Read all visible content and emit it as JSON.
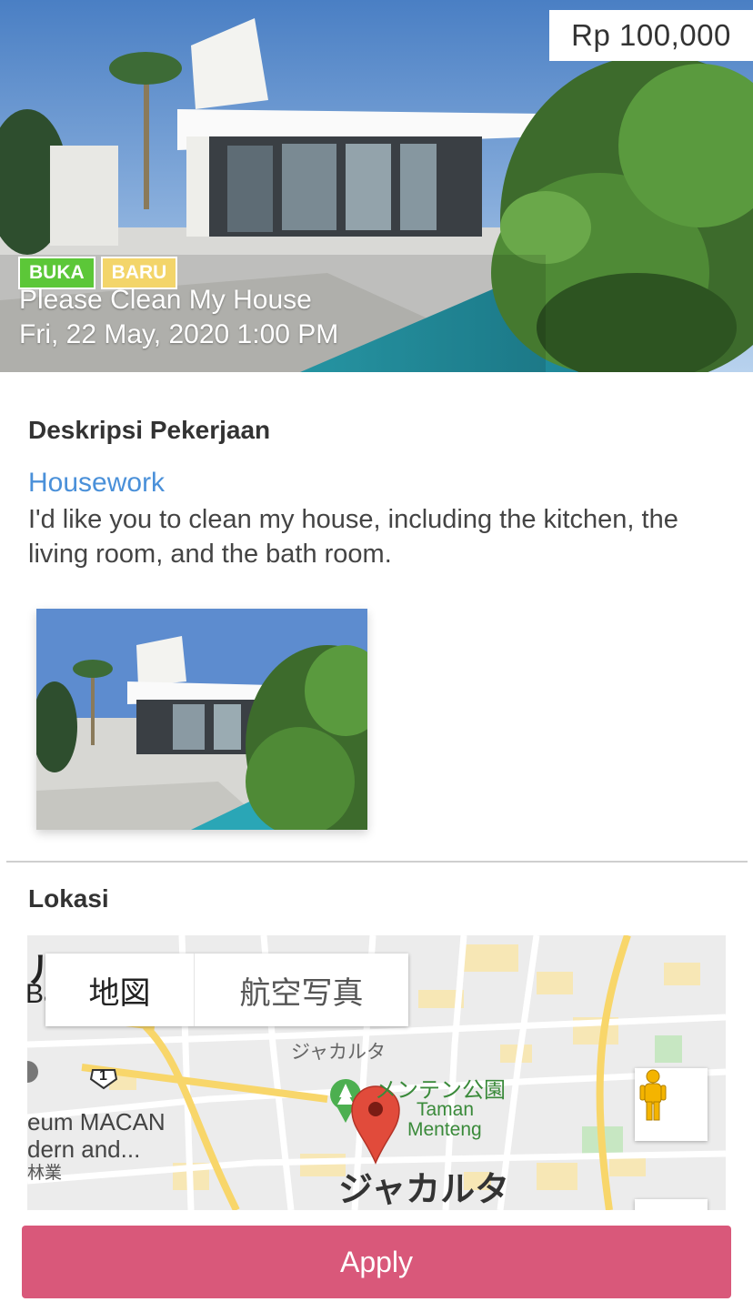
{
  "job": {
    "price": "Rp 100,000",
    "badges": {
      "status": "BUKA",
      "new": "BARU"
    },
    "title": "Please Clean My House",
    "datetime": "Fri, 22 May, 2020 1:00 PM"
  },
  "description": {
    "heading": "Deskripsi Pekerjaan",
    "category": "Housework",
    "text": "I'd like you to clean my house, including the kitchen, the living room, and the bath room."
  },
  "location": {
    "heading": "Lokasi",
    "map_type": {
      "map": "地図",
      "satellite": "航空写真"
    },
    "labels": {
      "fragment_top": "ル",
      "fragment_ba": "Ba",
      "jakarta_small": "ジャカルタ",
      "park_jp": "メンテン公園",
      "park_en_1": "Taman",
      "park_en_2": "Menteng",
      "museum_1": "eum MACAN",
      "museum_2": "dern and...",
      "fragment_kanji": "林業",
      "jakarta_big": "ジャカルタ",
      "road_number": "1"
    }
  },
  "actions": {
    "apply": "Apply"
  },
  "colors": {
    "accent": "#d9587a",
    "link": "#4a90d9",
    "badge_open": "#5cc738",
    "badge_new": "#f3d56a"
  }
}
